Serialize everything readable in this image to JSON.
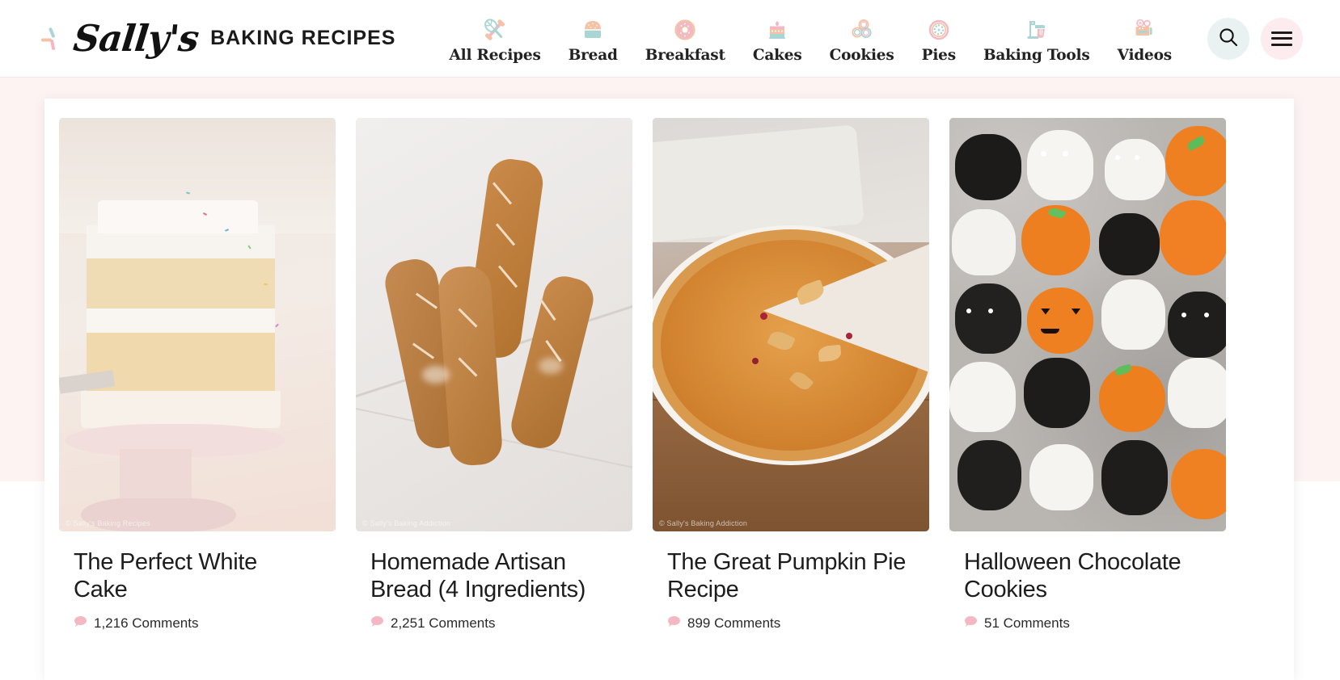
{
  "header": {
    "logo": {
      "script_text": "Sally's",
      "words_text": "BAKING RECIPES",
      "mark_icon": "whisk-strokes-icon"
    },
    "nav_items": [
      {
        "label": "All Recipes",
        "icon": "whisk-rolling-pin-icon"
      },
      {
        "label": "Bread",
        "icon": "bread-loaf-icon"
      },
      {
        "label": "Breakfast",
        "icon": "donut-icon"
      },
      {
        "label": "Cakes",
        "icon": "layer-cake-icon"
      },
      {
        "label": "Cookies",
        "icon": "cookies-icon"
      },
      {
        "label": "Pies",
        "icon": "pie-icon"
      },
      {
        "label": "Baking Tools",
        "icon": "stand-mixer-icon"
      },
      {
        "label": "Videos",
        "icon": "film-camera-icon"
      }
    ],
    "search_button": {
      "icon": "search-icon",
      "bg": "#e9f2f1"
    },
    "menu_button": {
      "icon": "hamburger-menu-icon",
      "bg": "#fcecef"
    }
  },
  "colors": {
    "page_background": "#fdf3f3",
    "card_background": "#ffffff",
    "accent_pink": "#f3b8c4",
    "accent_teal": "#a9d5d4",
    "accent_peach": "#f4c3a5",
    "text_dark": "#1d1d1d"
  },
  "main": {
    "cards": [
      {
        "title": "The Perfect White Cake",
        "comments": "1,216 Comments",
        "watermark": "© Sally's Baking Recipes",
        "image_alt": "slice-of-white-layer-cake-on-pink-cake-stand"
      },
      {
        "title": "Homemade Artisan Bread (4 Ingredients)",
        "comments": "2,251 Comments",
        "watermark": "© Sally's Baking Addiction",
        "image_alt": "four-rustic-bread-baguettes-on-marble"
      },
      {
        "title": "The Great Pumpkin Pie Recipe",
        "comments": "899 Comments",
        "watermark": "© Sally's Baking Addiction",
        "image_alt": "pumpkin-pie-in-white-dish-with-leaf-cutouts"
      },
      {
        "title": "Halloween Chocolate Cookies",
        "comments": "51 Comments",
        "watermark": "",
        "image_alt": "decorated-halloween-cookies-ghosts-pumpkins-bats"
      }
    ]
  }
}
